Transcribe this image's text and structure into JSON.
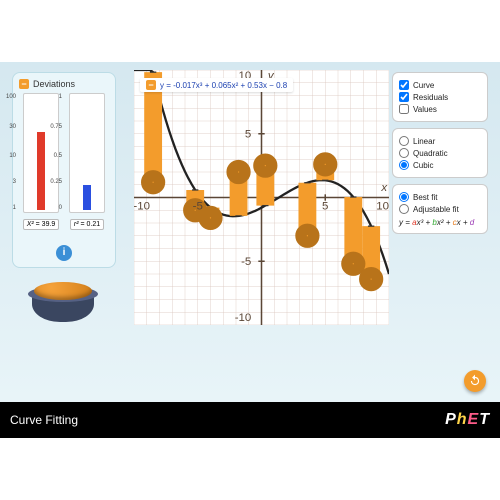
{
  "chart_data": {
    "type": "scatter",
    "title": "",
    "xlabel": "x",
    "ylabel": "y",
    "xlim": [
      -10,
      10
    ],
    "ylim": [
      -10,
      10
    ],
    "xticks": [
      -10,
      -5,
      5,
      10
    ],
    "yticks": [
      -10,
      -5,
      5,
      10
    ],
    "fit_curve": {
      "type": "cubic",
      "equation": "y = -0.017x^3 + 0.065x^2 + 0.53x - 0.8",
      "coeffs": {
        "a": -0.017,
        "b": 0.065,
        "c": 0.53,
        "d": -0.8
      }
    },
    "points": [
      {
        "x": -8.5,
        "y": 1.2
      },
      {
        "x": -5.2,
        "y": -1.0
      },
      {
        "x": -4.0,
        "y": -1.6
      },
      {
        "x": -1.8,
        "y": 2.0
      },
      {
        "x": 0.3,
        "y": 2.5
      },
      {
        "x": 3.6,
        "y": -3.0
      },
      {
        "x": 5.0,
        "y": 2.6
      },
      {
        "x": 7.2,
        "y": -5.2
      },
      {
        "x": 8.6,
        "y": -6.4
      }
    ]
  },
  "equation_display": "y = -0.017x³ + 0.065x² + 0.53x − 0.8",
  "deviations": {
    "title": "Deviations",
    "left_bar": {
      "ticks": [
        "100",
        "30",
        "10",
        "3",
        "1"
      ],
      "value_label": "X²",
      "value": "39.9",
      "fill_pct": 66
    },
    "right_bar": {
      "ticks": [
        "1",
        "0.75",
        "0.5",
        "0.25",
        "0"
      ],
      "value_label": "r²",
      "value": "0.21",
      "fill_pct": 21
    }
  },
  "display_options": [
    {
      "label": "Curve",
      "checked": true
    },
    {
      "label": "Residuals",
      "checked": true
    },
    {
      "label": "Values",
      "checked": false
    }
  ],
  "degree_options": [
    {
      "label": "Linear",
      "selected": false
    },
    {
      "label": "Quadratic",
      "selected": false
    },
    {
      "label": "Cubic",
      "selected": true
    }
  ],
  "fit_options": [
    {
      "label": "Best fit",
      "selected": true
    },
    {
      "label": "Adjustable fit",
      "selected": false
    }
  ],
  "fit_formula": {
    "a": "a",
    "b": "b",
    "c": "c",
    "d": "d",
    "eq": "y = ax³ + bx² + cx + d"
  },
  "footer": {
    "title": "Curve Fitting",
    "logo": "PhET"
  }
}
